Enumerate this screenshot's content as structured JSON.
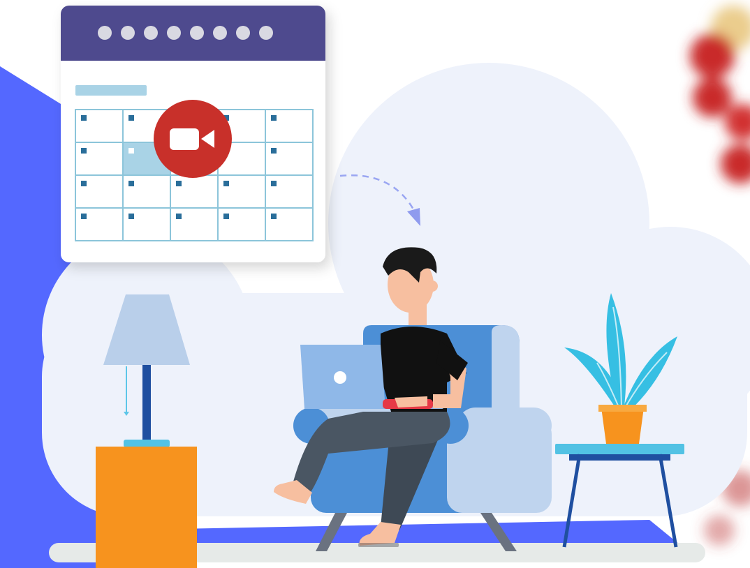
{
  "scene": {
    "description_hidden": "",
    "calendar": {
      "dot_count": 8,
      "rows": 4,
      "cols": 5,
      "highlighted_cell": [
        1,
        1
      ],
      "video_badge_icon": "video-camera-icon"
    },
    "colors": {
      "calendar_header": "#4E4A8E",
      "calendar_grid": "#8CC5DA",
      "calendar_marker": "#2A6E9A",
      "calendar_highlight": "#A9D3E6",
      "video_badge": "#C8302A",
      "blue_backdrop": "#5468FF",
      "cloud": "#EEF2FB",
      "lamp_shade": "#B9CFEA",
      "lamp_pole": "#1F4FA0",
      "side_table": "#F7931E",
      "chair_dark": "#4C8FD6",
      "chair_light": "#BFD4EE",
      "laptop": "#8FB8E8",
      "shirt": "#111111",
      "pants": "#4A5663",
      "skin": "#F7BFA0",
      "hair": "#1A1A1A",
      "plant": "#36BFE3",
      "pot": "#F7931E",
      "coffee_table_top": "#52C2E4",
      "coffee_table_legs": "#1F4FA0",
      "floor": "#E6EAE8"
    }
  }
}
